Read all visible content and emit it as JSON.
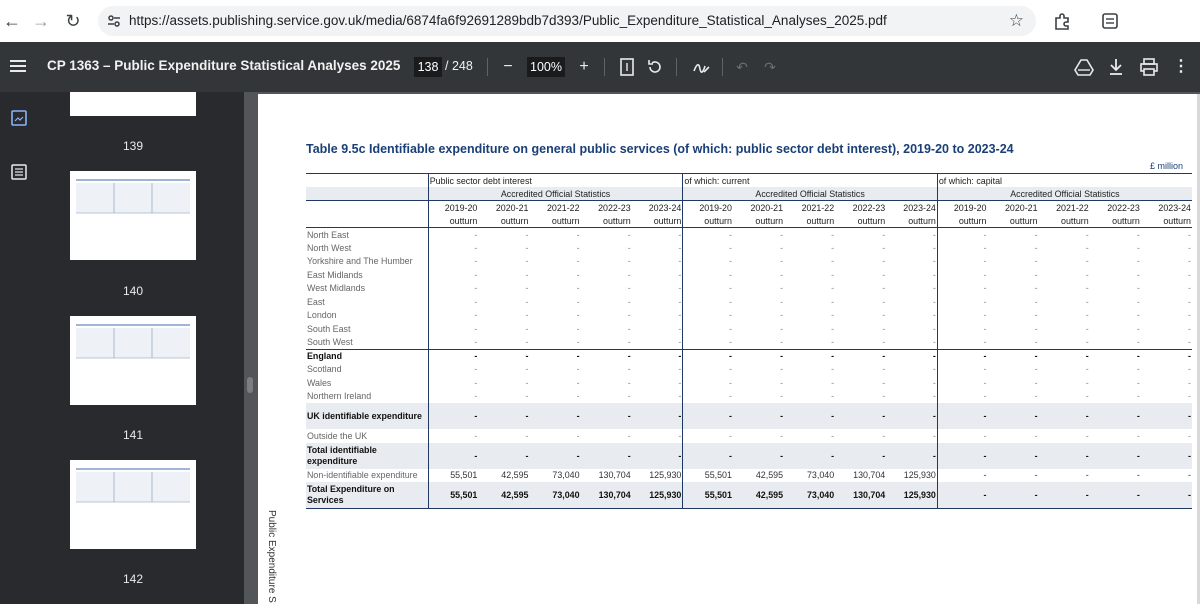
{
  "browser": {
    "url": "https://assets.publishing.service.gov.uk/media/6874fa6f92691289bdb7d393/Public_Expenditure_Statistical_Analyses_2025.pdf"
  },
  "toolbar": {
    "title": "CP 1363 – Public Expenditure Statistical Analyses 2025",
    "page_current": "138",
    "page_total": "/ 248",
    "zoom": "100%"
  },
  "sidebar": {
    "thumbnails": [
      {
        "label": "139"
      },
      {
        "label": "140"
      },
      {
        "label": "141"
      },
      {
        "label": "142"
      }
    ]
  },
  "document": {
    "table_title": "Table 9.5c Identifiable expenditure on general public services (of which: public sector debt interest), 2019-20 to 2023-24",
    "unit": "£ million",
    "side_text": "Public Expenditure S",
    "groups": [
      "Public sector debt interest",
      "of which: current",
      "of which: capital"
    ],
    "sub_header": "Accredited Official Statistics",
    "years": [
      "2019-20",
      "2020-21",
      "2021-22",
      "2022-23",
      "2023-24"
    ],
    "outturn": "outturn",
    "rows": [
      {
        "label": "North East",
        "values": [
          "-",
          "-",
          "-",
          "-",
          "-",
          "-",
          "-",
          "-",
          "-",
          "-",
          "-",
          "-",
          "-",
          "-",
          "-"
        ]
      },
      {
        "label": "North West",
        "values": [
          "-",
          "-",
          "-",
          "-",
          "-",
          "-",
          "-",
          "-",
          "-",
          "-",
          "-",
          "-",
          "-",
          "-",
          "-"
        ]
      },
      {
        "label": "Yorkshire and The Humber",
        "values": [
          "-",
          "-",
          "-",
          "-",
          "-",
          "-",
          "-",
          "-",
          "-",
          "-",
          "-",
          "-",
          "-",
          "-",
          "-"
        ]
      },
      {
        "label": "East Midlands",
        "values": [
          "-",
          "-",
          "-",
          "-",
          "-",
          "-",
          "-",
          "-",
          "-",
          "-",
          "-",
          "-",
          "-",
          "-",
          "-"
        ]
      },
      {
        "label": "West Midlands",
        "values": [
          "-",
          "-",
          "-",
          "-",
          "-",
          "-",
          "-",
          "-",
          "-",
          "-",
          "-",
          "-",
          "-",
          "-",
          "-"
        ]
      },
      {
        "label": "East",
        "values": [
          "-",
          "-",
          "-",
          "-",
          "-",
          "-",
          "-",
          "-",
          "-",
          "-",
          "-",
          "-",
          "-",
          "-",
          "-"
        ]
      },
      {
        "label": "London",
        "values": [
          "-",
          "-",
          "-",
          "-",
          "-",
          "-",
          "-",
          "-",
          "-",
          "-",
          "-",
          "-",
          "-",
          "-",
          "-"
        ]
      },
      {
        "label": "South East",
        "values": [
          "-",
          "-",
          "-",
          "-",
          "-",
          "-",
          "-",
          "-",
          "-",
          "-",
          "-",
          "-",
          "-",
          "-",
          "-"
        ]
      },
      {
        "label": "South West",
        "values": [
          "-",
          "-",
          "-",
          "-",
          "-",
          "-",
          "-",
          "-",
          "-",
          "-",
          "-",
          "-",
          "-",
          "-",
          "-"
        ]
      },
      {
        "label": "England",
        "values": [
          "-",
          "-",
          "-",
          "-",
          "-",
          "-",
          "-",
          "-",
          "-",
          "-",
          "-",
          "-",
          "-",
          "-",
          "-"
        ]
      },
      {
        "label": "Scotland",
        "values": [
          "-",
          "-",
          "-",
          "-",
          "-",
          "-",
          "-",
          "-",
          "-",
          "-",
          "-",
          "-",
          "-",
          "-",
          "-"
        ]
      },
      {
        "label": "Wales",
        "values": [
          "-",
          "-",
          "-",
          "-",
          "-",
          "-",
          "-",
          "-",
          "-",
          "-",
          "-",
          "-",
          "-",
          "-",
          "-"
        ]
      },
      {
        "label": "Northern Ireland",
        "values": [
          "-",
          "-",
          "-",
          "-",
          "-",
          "-",
          "-",
          "-",
          "-",
          "-",
          "-",
          "-",
          "-",
          "-",
          "-"
        ]
      },
      {
        "label": "UK identifiable expenditure",
        "values": [
          "-",
          "-",
          "-",
          "-",
          "-",
          "-",
          "-",
          "-",
          "-",
          "-",
          "-",
          "-",
          "-",
          "-",
          "-"
        ]
      },
      {
        "label": "Outside the UK",
        "values": [
          "-",
          "-",
          "-",
          "-",
          "-",
          "-",
          "-",
          "-",
          "-",
          "-",
          "-",
          "-",
          "-",
          "-",
          "-"
        ]
      },
      {
        "label": "Total identifiable expenditure",
        "values": [
          "-",
          "-",
          "-",
          "-",
          "-",
          "-",
          "-",
          "-",
          "-",
          "-",
          "-",
          "-",
          "-",
          "-",
          "-"
        ]
      },
      {
        "label": "Non-identifiable expenditure",
        "values": [
          "55,501",
          "42,595",
          "73,040",
          "130,704",
          "125,930",
          "55,501",
          "42,595",
          "73,040",
          "130,704",
          "125,930",
          "-",
          "-",
          "-",
          "-",
          "-"
        ]
      },
      {
        "label": "Total Expenditure on Services",
        "values": [
          "55,501",
          "42,595",
          "73,040",
          "130,704",
          "125,930",
          "55,501",
          "42,595",
          "73,040",
          "130,704",
          "125,930",
          "-",
          "-",
          "-",
          "-",
          "-"
        ]
      }
    ]
  }
}
